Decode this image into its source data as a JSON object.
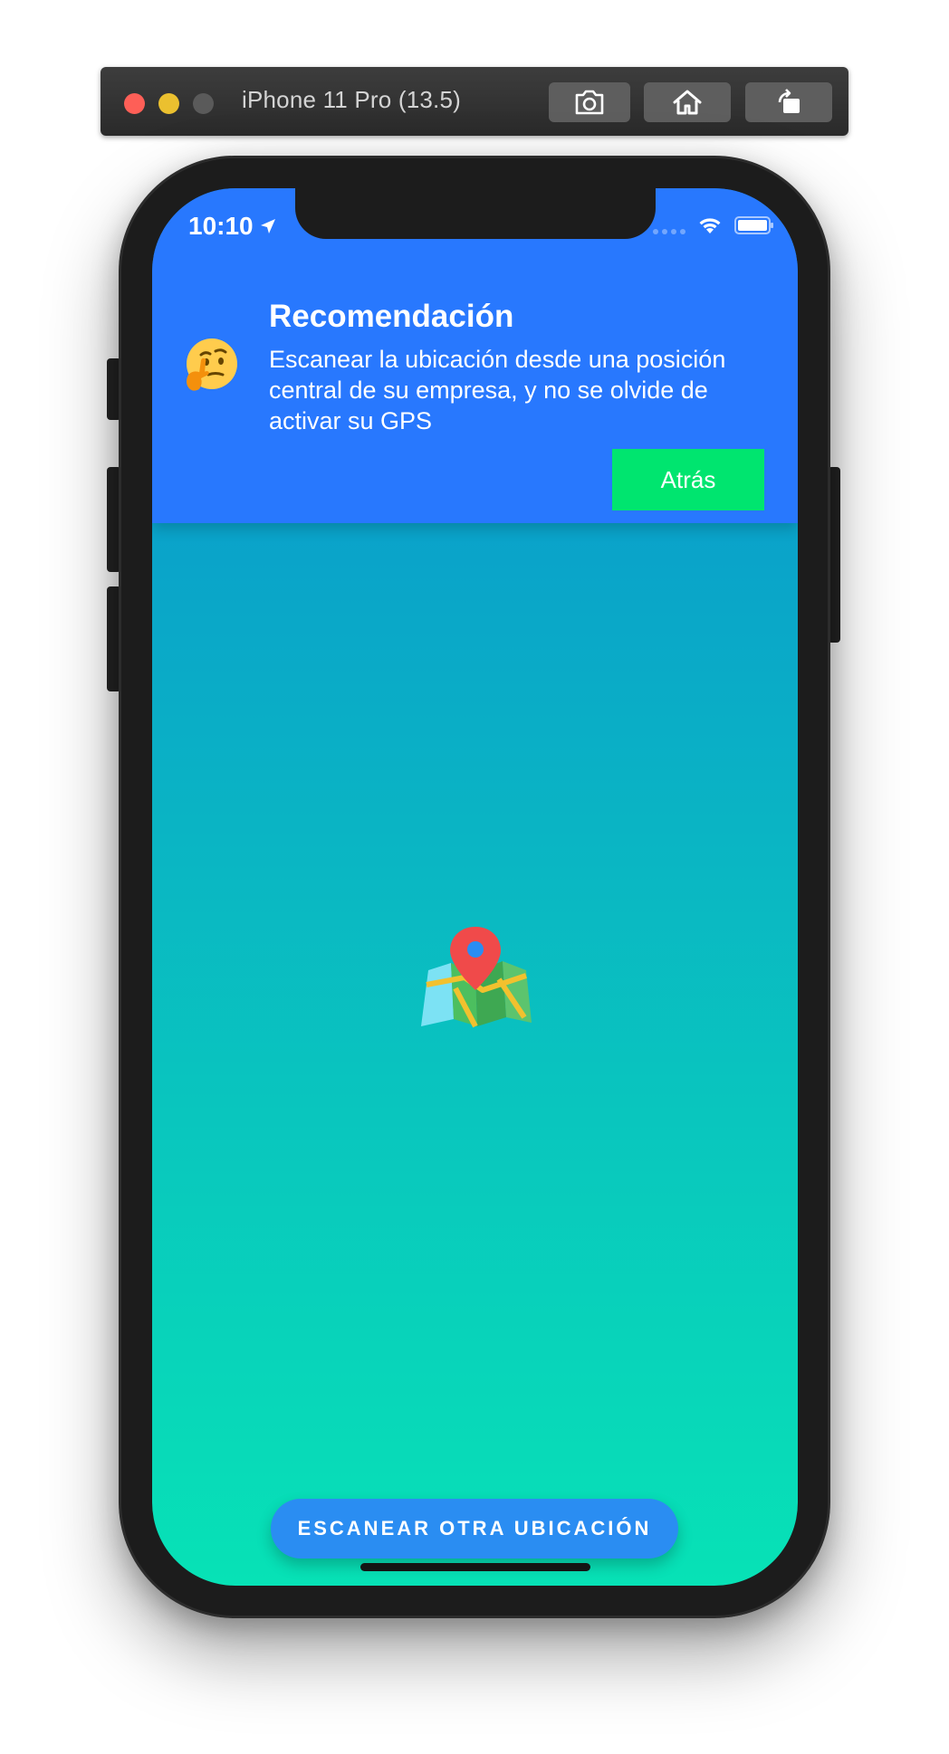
{
  "simulator": {
    "title": "iPhone 11 Pro (13.5)",
    "toolbar_buttons": [
      "screenshot-icon",
      "home-icon",
      "rotate-icon"
    ]
  },
  "status_bar": {
    "time": "10:10",
    "icons": [
      "location-arrow-icon",
      "signal-icon",
      "wifi-icon",
      "battery-icon"
    ]
  },
  "recommendation": {
    "emoji": "thinking-face-icon",
    "title": "Recomendación",
    "body": "Escanear la ubicación desde una posición central de su empresa, y no se olvide de activar su GPS",
    "back_label": "Atrás"
  },
  "main": {
    "icon": "map-pin-icon",
    "scan_button_label": "ESCANEAR OTRA UBICACIÓN"
  },
  "colors": {
    "header": "#2878fe",
    "back_button": "#00e56f",
    "scan_button": "#2a8df2",
    "gradient_top": "#0a8fd0",
    "gradient_bottom": "#07e2b6"
  }
}
